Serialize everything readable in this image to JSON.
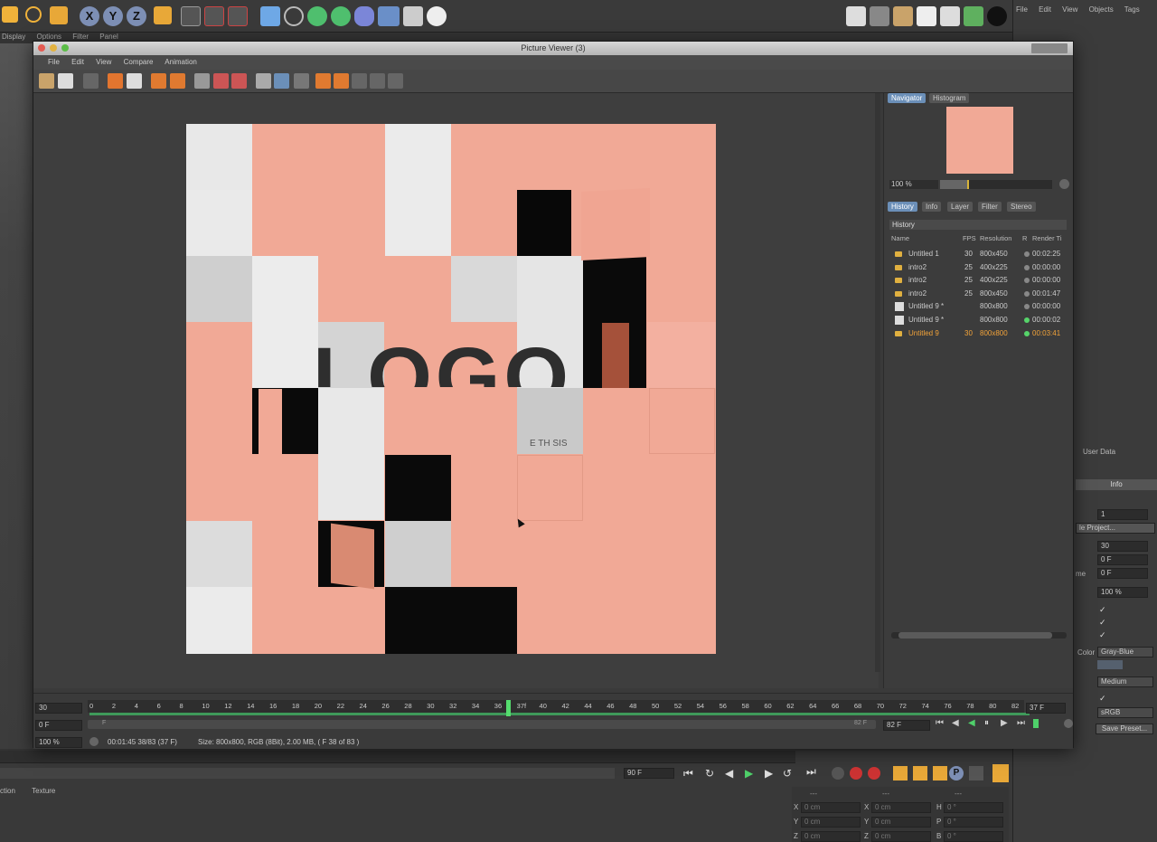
{
  "app": {
    "bg_menu": [
      "Display",
      "Options",
      "Filter",
      "Panel"
    ],
    "right_menu": [
      "File",
      "Edit",
      "View",
      "Objects",
      "Tags"
    ],
    "right_panel": {
      "user_data": "User Data",
      "info_tab": "Info",
      "field_1": "1",
      "project_label": "le Project...",
      "fps": "30",
      "min_time": "0 F",
      "max_time": "0 F",
      "me_label": "me",
      "zoom": "100 %",
      "color_label": "Color",
      "color_value": "Gray-Blue",
      "quality": "Medium",
      "profile": "sRGB",
      "save_preset": "Save Preset..."
    },
    "bottom": {
      "tab1": "ction",
      "tab2": "Texture",
      "frame_field": "90 F",
      "frame_field2": "90 F",
      "coords": [
        {
          "axis": "X",
          "val": "0 cm",
          "axis2": "X",
          "val2": "0 cm",
          "axis3": "H",
          "val3": "0 °"
        },
        {
          "axis": "Y",
          "val": "0 cm",
          "axis2": "Y",
          "val2": "0 cm",
          "axis3": "P",
          "val3": "0 °"
        },
        {
          "axis": "Z",
          "val": "0 cm",
          "axis2": "Z",
          "val2": "0 cm",
          "axis3": "B",
          "val3": "0 °"
        }
      ],
      "dashes": "---"
    }
  },
  "window": {
    "title": "Picture Viewer (3)",
    "menu": [
      "File",
      "Edit",
      "View",
      "Compare",
      "Animation"
    ],
    "image_text": {
      "logo": "LOGO",
      "sub": "E TH SIS"
    }
  },
  "navigator": {
    "tabs": [
      "Navigator",
      "Histogram"
    ],
    "zoom": "100 %"
  },
  "history": {
    "tabs": [
      "History",
      "Info",
      "Layer",
      "Filter",
      "Stereo"
    ],
    "heading": "History",
    "columns": [
      "Name",
      "FPS",
      "Resolution",
      "R",
      "Render Ti"
    ],
    "rows": [
      {
        "name": "Untitled 1",
        "fps": "30",
        "res": "800x450",
        "time": "00:02:25",
        "status": "#888888"
      },
      {
        "name": "intro2",
        "fps": "25",
        "res": "400x225",
        "time": "00:00:00",
        "status": "#888888"
      },
      {
        "name": "intro2",
        "fps": "25",
        "res": "400x225",
        "time": "00:00:00",
        "status": "#888888"
      },
      {
        "name": "intro2",
        "fps": "25",
        "res": "800x450",
        "time": "00:01:47",
        "status": "#888888"
      },
      {
        "name": "Untitled 9 *",
        "fps": "",
        "res": "800x800",
        "time": "00:00:00",
        "status": "#888888"
      },
      {
        "name": "Untitled 9 *",
        "fps": "",
        "res": "800x800",
        "time": "00:00:02",
        "status": "#56d46a"
      },
      {
        "name": "Untitled 9",
        "fps": "30",
        "res": "800x800",
        "time": "00:03:41",
        "status": "#56d46a",
        "selected": true
      }
    ]
  },
  "timeline": {
    "fps_field": "30",
    "start_field": "0 F",
    "zoom_field": "100 %",
    "ticks": [
      "0",
      "2",
      "4",
      "6",
      "8",
      "10",
      "12",
      "14",
      "16",
      "18",
      "20",
      "22",
      "24",
      "26",
      "28",
      "30",
      "32",
      "34",
      "36",
      "37f",
      "40",
      "42",
      "44",
      "46",
      "48",
      "50",
      "52",
      "54",
      "56",
      "58",
      "60",
      "62",
      "64",
      "66",
      "68",
      "70",
      "72",
      "74",
      "76",
      "78",
      "80",
      "82"
    ],
    "current": "37 F",
    "end_field": "82 F",
    "end_small": "82 F",
    "start_small": "F",
    "status": "00:01:45 38/83 (37 F)",
    "info": "Size: 800x800, RGB (8Bit), 2.00 MB,  ( F 38 of 83 )"
  },
  "colors": {
    "accent": "#6b8fb8",
    "salmon": "#f1a996",
    "selected": "#f2a33a",
    "green": "#3f9a5a"
  }
}
